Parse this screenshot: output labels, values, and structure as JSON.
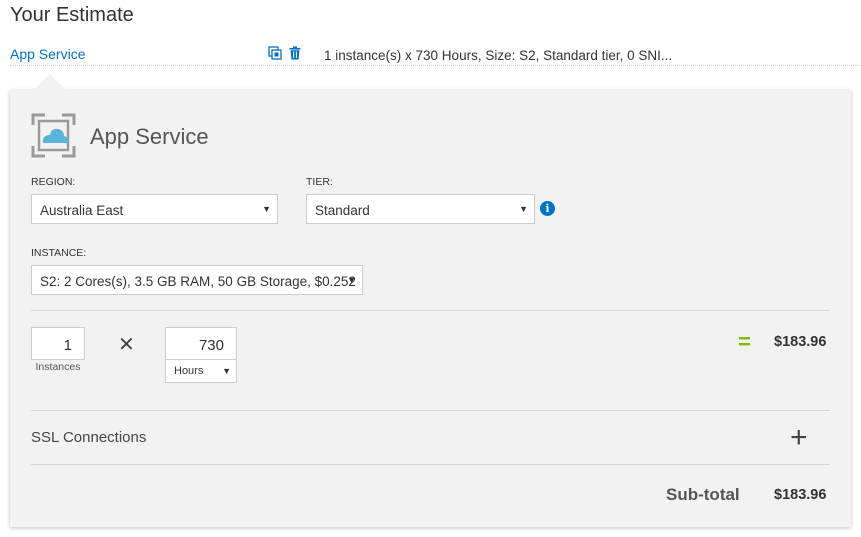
{
  "page": {
    "title": "Your Estimate"
  },
  "estimate_row": {
    "service_link": "App Service",
    "icons": [
      "copy-icon",
      "trash-icon"
    ],
    "summary": "1 instance(s) x 730 Hours, Size: S2, Standard tier, 0 SNI..."
  },
  "panel": {
    "service_title": "App Service",
    "region": {
      "label": "REGION:",
      "value": "Australia East"
    },
    "tier": {
      "label": "TIER:",
      "value": "Standard",
      "info_icon": "i"
    },
    "instance": {
      "label": "INSTANCE:",
      "value": "S2: 2 Cores(s), 3.5 GB RAM, 50 GB Storage, $0.252"
    },
    "calc": {
      "instances_value": "1",
      "instances_label": "Instances",
      "times_symbol": "✕",
      "hours_value": "730",
      "hours_unit": "Hours",
      "equals_symbol": "=",
      "price": "$183.96"
    },
    "ssl": {
      "label": "SSL Connections",
      "add_symbol": "+"
    },
    "subtotal": {
      "label": "Sub-total",
      "value": "$183.96"
    }
  },
  "colors": {
    "accent": "#0072c6",
    "equals": "#7fba00",
    "panel_bg": "#f2f2f2"
  }
}
